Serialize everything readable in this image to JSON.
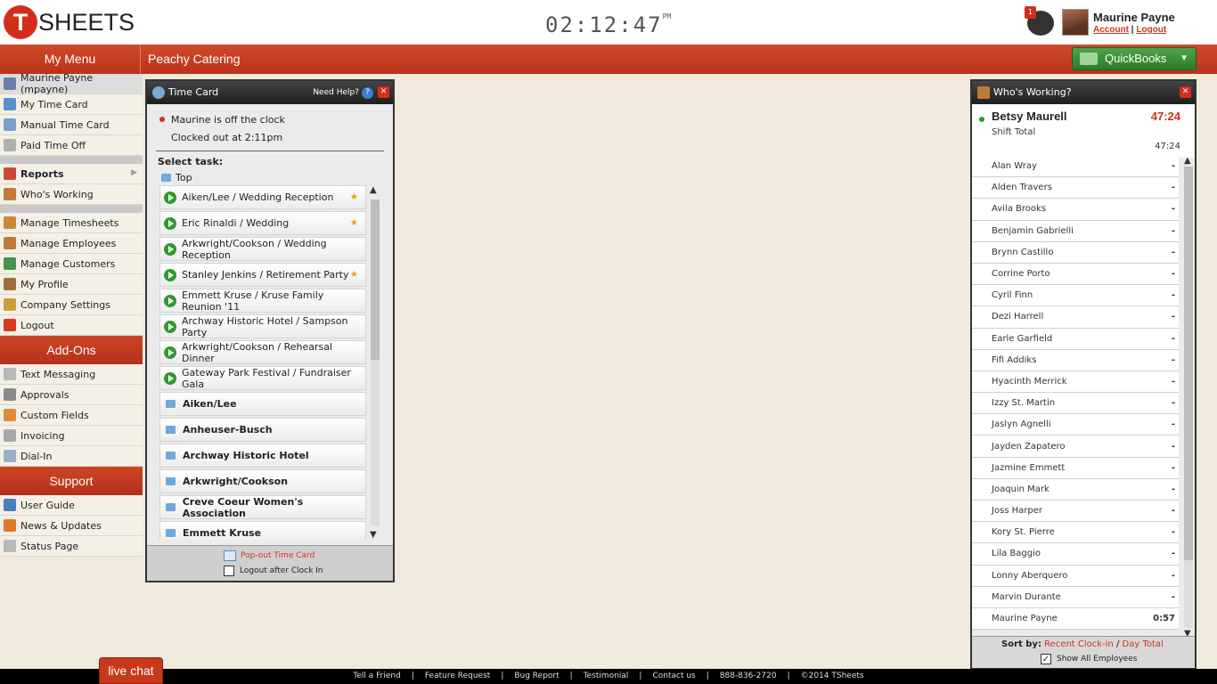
{
  "header": {
    "logo_letter": "T",
    "logo_rest": "SHEETS",
    "clock": "02:12:47",
    "clock_suffix": "PM",
    "notification_count": "1",
    "user_name": "Maurine Payne",
    "account_link": "Account",
    "logout_link": "Logout"
  },
  "menubar": {
    "my_menu": "My Menu",
    "company": "Peachy Catering",
    "quickbooks": "QuickBooks"
  },
  "sidebar": {
    "items_main": [
      {
        "label": "Maurine Payne (mpayne)",
        "icon": "user-icon",
        "color": "#6a7fa8"
      },
      {
        "label": "My Time Card",
        "icon": "clock-icon",
        "color": "#5c8fc8"
      },
      {
        "label": "Manual Time Card",
        "icon": "calendar-icon",
        "color": "#7aa0c8"
      },
      {
        "label": "Paid Time Off",
        "icon": "pto-icon",
        "color": "#b0b0b0"
      }
    ],
    "items_reports": [
      {
        "label": "Reports",
        "icon": "chart-icon",
        "color": "#c94a3a"
      },
      {
        "label": "Who's Working",
        "icon": "people-icon",
        "color": "#c07a3a"
      }
    ],
    "items_manage": [
      {
        "label": "Manage Timesheets",
        "icon": "timesheet-icon",
        "color": "#c8893a"
      },
      {
        "label": "Manage Employees",
        "icon": "employees-icon",
        "color": "#c07a3a"
      },
      {
        "label": "Manage Customers",
        "icon": "customers-icon",
        "color": "#4a8f4a"
      },
      {
        "label": "My Profile",
        "icon": "profile-icon",
        "color": "#a0703a"
      },
      {
        "label": "Company Settings",
        "icon": "settings-icon",
        "color": "#c8a03a"
      },
      {
        "label": "Logout",
        "icon": "logout-icon",
        "color": "#d33c1c"
      }
    ],
    "addons_header": "Add-Ons",
    "items_addons": [
      {
        "label": "Text Messaging",
        "icon": "envelope-icon",
        "color": "#b8b8b8"
      },
      {
        "label": "Approvals",
        "icon": "approval-icon",
        "color": "#8a8a8a"
      },
      {
        "label": "Custom Fields",
        "icon": "tag-icon",
        "color": "#e08a3a"
      },
      {
        "label": "Invoicing",
        "icon": "invoice-icon",
        "color": "#a8a8a8"
      },
      {
        "label": "Dial-In",
        "icon": "phone-icon",
        "color": "#9ab0c8"
      }
    ],
    "support_header": "Support",
    "items_support": [
      {
        "label": "User Guide",
        "icon": "guide-icon",
        "color": "#4a7fc0"
      },
      {
        "label": "News & Updates",
        "icon": "rss-icon",
        "color": "#e0782a"
      },
      {
        "label": "Status Page",
        "icon": "status-icon",
        "color": "#b8b8b8"
      }
    ]
  },
  "timecard": {
    "title": "Time Card",
    "need_help": "Need Help?",
    "status_line": "Maurine is off the clock",
    "clocked_out": "Clocked out at 2:11pm",
    "select_task": "Select task:",
    "top": "Top",
    "tasks": [
      {
        "label": "Aiken/Lee / Wedding Reception",
        "kind": "job",
        "starred": true
      },
      {
        "label": "Eric Rinaldi / Wedding",
        "kind": "job",
        "starred": true
      },
      {
        "label": "Arkwright/Cookson / Wedding Reception",
        "kind": "job",
        "starred": false
      },
      {
        "label": "Stanley Jenkins / Retirement Party",
        "kind": "job",
        "starred": true
      },
      {
        "label": "Emmett Kruse / Kruse Family Reunion '11",
        "kind": "job",
        "starred": false
      },
      {
        "label": "Archway Historic Hotel / Sampson Party",
        "kind": "job",
        "starred": false
      },
      {
        "label": "Arkwright/Cookson / Rehearsal Dinner",
        "kind": "job",
        "starred": false
      },
      {
        "label": "Gateway Park Festival / Fundraiser Gala",
        "kind": "job",
        "starred": false
      },
      {
        "label": "Aiken/Lee",
        "kind": "customer",
        "starred": false
      },
      {
        "label": "Anheuser-Busch",
        "kind": "customer",
        "starred": false
      },
      {
        "label": "Archway Historic Hotel",
        "kind": "customer",
        "starred": false
      },
      {
        "label": "Arkwright/Cookson",
        "kind": "customer",
        "starred": false
      },
      {
        "label": "Creve Coeur Women's Association",
        "kind": "customer",
        "starred": false
      },
      {
        "label": "Emmett Kruse",
        "kind": "customer",
        "starred": false
      }
    ],
    "popout": "Pop-out Time Card",
    "logout_after": "Logout after Clock In"
  },
  "whos_working": {
    "title": "Who's Working?",
    "active_name": "Betsy Maurell",
    "active_time": "47:24",
    "shift_total_label": "Shift Total",
    "shift_total_value": "47:24",
    "employees": [
      {
        "name": "Alan Wray",
        "value": "-"
      },
      {
        "name": "Alden Travers",
        "value": "-"
      },
      {
        "name": "Avila Brooks",
        "value": "-"
      },
      {
        "name": "Benjamin Gabrielli",
        "value": "-"
      },
      {
        "name": "Brynn Castillo",
        "value": "-"
      },
      {
        "name": "Corrine Porto",
        "value": "-"
      },
      {
        "name": "Cyril Finn",
        "value": "-"
      },
      {
        "name": "Dezi Harrell",
        "value": "-"
      },
      {
        "name": "Earle Garfield",
        "value": "-"
      },
      {
        "name": "Fifi Addiks",
        "value": "-"
      },
      {
        "name": "Hyacinth Merrick",
        "value": "-"
      },
      {
        "name": "Izzy St. Martin",
        "value": "-"
      },
      {
        "name": "Jaslyn Agnelli",
        "value": "-"
      },
      {
        "name": "Jayden Zapatero",
        "value": "-"
      },
      {
        "name": "Jazmine Emmett",
        "value": "-"
      },
      {
        "name": "Joaquin Mark",
        "value": "-"
      },
      {
        "name": "Joss Harper",
        "value": "-"
      },
      {
        "name": "Kory St. Pierre",
        "value": "-"
      },
      {
        "name": "Lila Baggio",
        "value": "-"
      },
      {
        "name": "Lonny Aberquero",
        "value": "-"
      },
      {
        "name": "Marvin Durante",
        "value": "-"
      },
      {
        "name": "Maurine Payne",
        "value": "0:57"
      }
    ],
    "sort_by": "Sort by:",
    "sort_recent": "Recent Clock-in",
    "sort_sep": "/",
    "sort_day": "Day Total",
    "show_all": "Show All Employees",
    "show_all_checked": true
  },
  "footer": {
    "links": [
      "Tell a Friend",
      "Feature Request",
      "Bug Report",
      "Testimonial",
      "Contact us",
      "888-836-2720",
      "©2014 TSheets"
    ],
    "live_chat": "live chat"
  }
}
